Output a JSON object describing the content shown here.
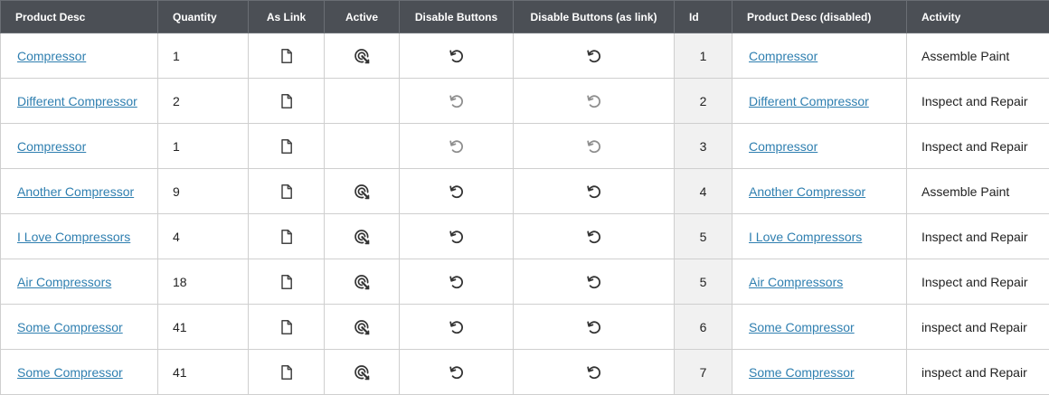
{
  "columns": [
    "Product Desc",
    "Quantity",
    "As Link",
    "Active",
    "Disable Buttons",
    "Disable Buttons (as link)",
    "Id",
    "Product Desc (disabled)",
    "Activity"
  ],
  "icons": {
    "as_link": "document-icon",
    "active": "target-pointer-icon",
    "disable": "undo-icon"
  },
  "colors": {
    "header_bg": "#4b4f55",
    "link": "#2f7fb0",
    "id_column_bg": "#f1f1f1"
  },
  "rows": [
    {
      "desc": "Compressor",
      "quantity": "1",
      "active": true,
      "buttons_enabled": true,
      "id": "1",
      "desc_disabled": "Compressor",
      "activity": "Assemble Paint"
    },
    {
      "desc": "Different Compressor",
      "quantity": "2",
      "active": false,
      "buttons_enabled": false,
      "id": "2",
      "desc_disabled": "Different Compressor",
      "activity": "Inspect and Repair"
    },
    {
      "desc": "Compressor",
      "quantity": "1",
      "active": false,
      "buttons_enabled": false,
      "id": "3",
      "desc_disabled": "Compressor",
      "activity": "Inspect and Repair"
    },
    {
      "desc": "Another Compressor",
      "quantity": "9",
      "active": true,
      "buttons_enabled": true,
      "id": "4",
      "desc_disabled": "Another Compressor",
      "activity": "Assemble Paint"
    },
    {
      "desc": "I Love Compressors",
      "quantity": "4",
      "active": true,
      "buttons_enabled": true,
      "id": "5",
      "desc_disabled": "I Love Compressors",
      "activity": "Inspect and Repair"
    },
    {
      "desc": "Air Compressors",
      "quantity": "18",
      "active": true,
      "buttons_enabled": true,
      "id": "5",
      "desc_disabled": "Air Compressors",
      "activity": "Inspect and Repair"
    },
    {
      "desc": "Some Compressor",
      "quantity": "41",
      "active": true,
      "buttons_enabled": true,
      "id": "6",
      "desc_disabled": "Some Compressor",
      "activity": "inspect and Repair"
    },
    {
      "desc": "Some Compressor",
      "quantity": "41",
      "active": true,
      "buttons_enabled": true,
      "id": "7",
      "desc_disabled": "Some Compressor",
      "activity": "inspect and Repair"
    }
  ]
}
